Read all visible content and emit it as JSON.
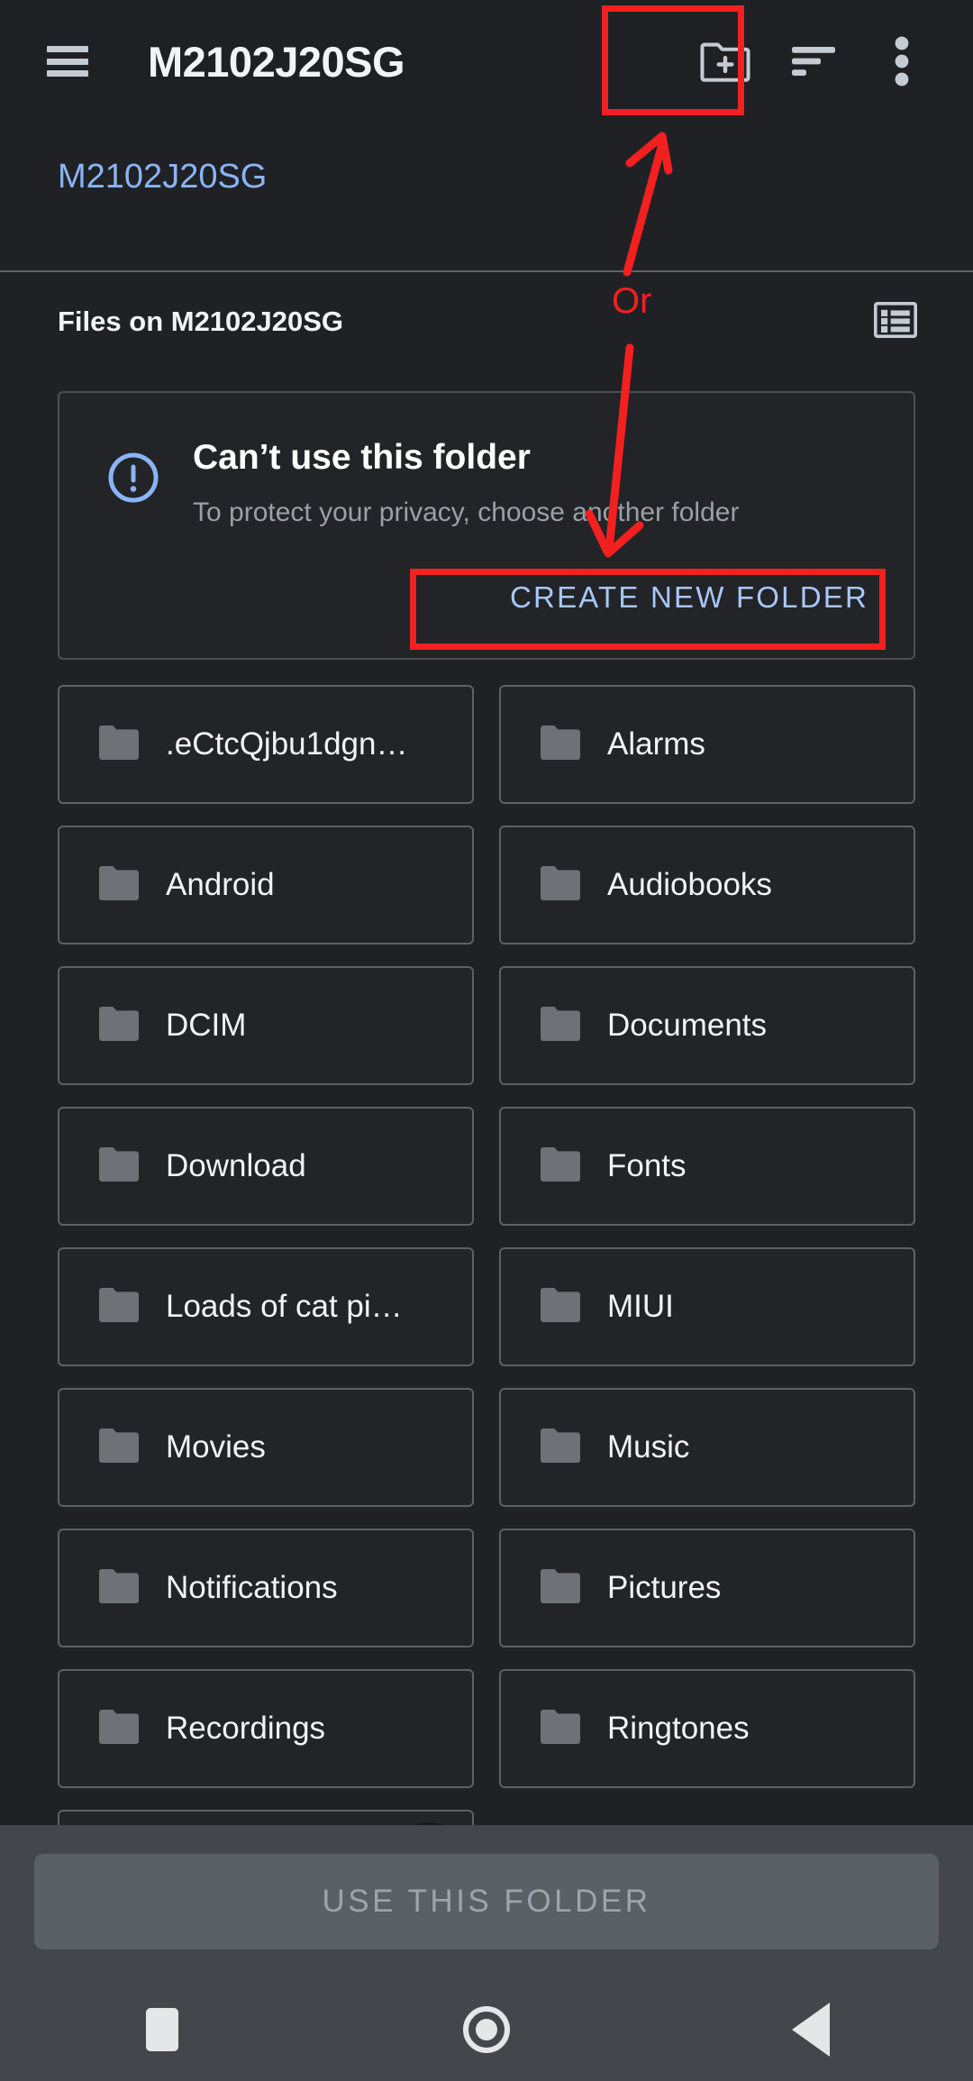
{
  "appbar": {
    "menu_icon": "hamburger-menu-icon",
    "title": "M2102J20SG",
    "actions": [
      {
        "name": "create-new-folder-icon",
        "label": "Create new folder"
      },
      {
        "name": "sort-icon",
        "label": "Sort"
      },
      {
        "name": "overflow-menu-icon",
        "label": "More options"
      }
    ]
  },
  "breadcrumb": {
    "current": "M2102J20SG"
  },
  "section": {
    "files_on_label": "Files on M2102J20SG",
    "view_toggle_icon": "list-view-icon"
  },
  "warning_card": {
    "icon": "error-outline-icon",
    "title": "Can’t use this folder",
    "subtitle": "To protect your privacy, choose another folder",
    "action_label": "CREATE NEW FOLDER"
  },
  "folders": [
    {
      "name": ".eCtcQjbu1dgn…"
    },
    {
      "name": "Alarms"
    },
    {
      "name": "Android"
    },
    {
      "name": "Audiobooks"
    },
    {
      "name": "DCIM"
    },
    {
      "name": "Documents"
    },
    {
      "name": "Download"
    },
    {
      "name": "Fonts"
    },
    {
      "name": "Loads of cat pi…"
    },
    {
      "name": "MIUI"
    },
    {
      "name": "Movies"
    },
    {
      "name": "Music"
    },
    {
      "name": "Notifications"
    },
    {
      "name": "Pictures"
    },
    {
      "name": "Recordings"
    },
    {
      "name": "Ringtones"
    },
    {
      "name": ""
    },
    {
      "name": ""
    }
  ],
  "bottom": {
    "use_folder_label": "USE THIS FOLDER",
    "use_folder_enabled": false
  },
  "navbar": {
    "recents_icon": "recents-square-icon",
    "home_icon": "home-circle-icon",
    "back_icon": "back-triangle-icon"
  },
  "annotations": {
    "or_label": "Or",
    "highlight_color": "#f32020",
    "arrow_up_target": "create-new-folder-icon",
    "arrow_down_target": "create-new-folder-button"
  },
  "colors": {
    "page_background": "#202124",
    "appbar_background": "#1f2023",
    "card_background": "#222427",
    "card_border": "#5c6166",
    "accent_blue": "#8ab4f8",
    "button_blue": "#a8c7fa",
    "bottom_bar": "#43474b",
    "annotation_red": "#f32020"
  }
}
